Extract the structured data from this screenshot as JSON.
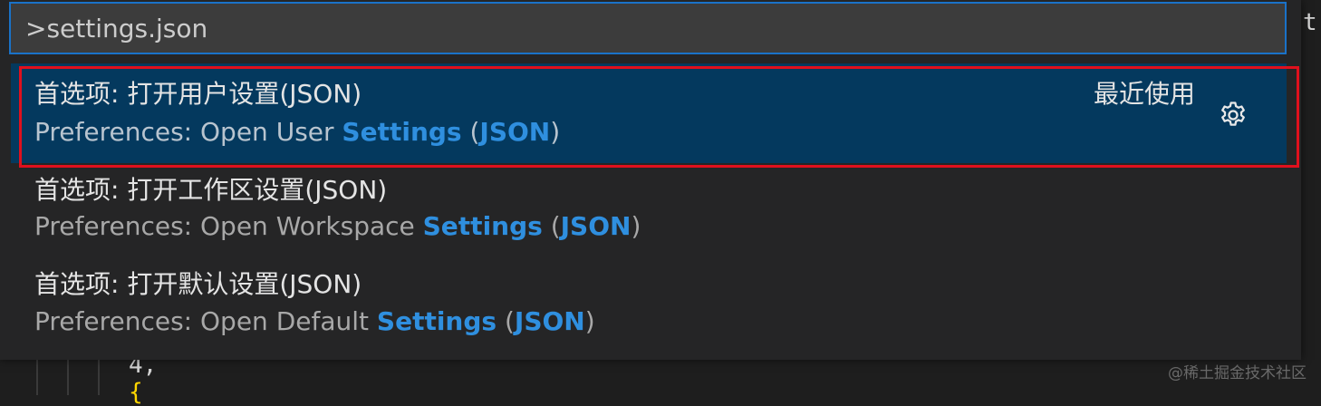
{
  "editor": {
    "code_lines": [
      "4,",
      "{"
    ],
    "partial_right_text": "tr"
  },
  "watermark": "@稀土掘金技术社区",
  "quick_input": {
    "value": ">settings.json",
    "items": [
      {
        "label": "首选项: 打开用户设置(JSON)",
        "desc_prefix": "Preferences: Open User ",
        "desc_match1": "Settings",
        "desc_mid": " (",
        "desc_match2": "JSON",
        "desc_suffix": ")",
        "badge": "最近使用",
        "selected": true,
        "action_icon": "gear-icon"
      },
      {
        "label": "首选项: 打开工作区设置(JSON)",
        "desc_prefix": "Preferences: Open Workspace ",
        "desc_match1": "Settings",
        "desc_mid": " (",
        "desc_match2": "JSON",
        "desc_suffix": ")",
        "selected": false
      },
      {
        "label": "首选项: 打开默认设置(JSON)",
        "desc_prefix": "Preferences: Open Default ",
        "desc_match1": "Settings",
        "desc_mid": " (",
        "desc_match2": "JSON",
        "desc_suffix": ")",
        "selected": false
      }
    ]
  },
  "colors": {
    "input_border": "#1a72c8",
    "selected_bg": "#04395e",
    "highlight": "#2f8fdf",
    "annotation_frame": "#e0101d"
  }
}
